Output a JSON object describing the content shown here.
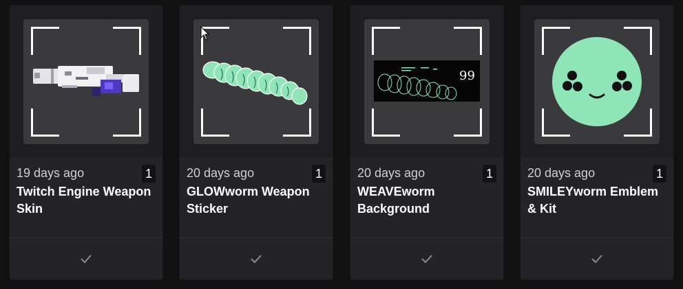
{
  "cards": [
    {
      "date": "19 days ago",
      "count": "1",
      "title": "Twitch Engine Weapon Skin",
      "image": "weapon-skin-image"
    },
    {
      "date": "20 days ago",
      "count": "1",
      "title": "GLOWworm Weapon Sticker",
      "image": "glowworm-sticker-image"
    },
    {
      "date": "20 days ago",
      "count": "1",
      "title": "WEAVEworm Background",
      "image": "weaveworm-background-image",
      "image_text": "99"
    },
    {
      "date": "20 days ago",
      "count": "1",
      "title": "SMILEYworm Emblem & Kit",
      "image": "smileyworm-emblem-image"
    }
  ],
  "colors": {
    "page_bg": "#111112",
    "card_bg": "#242428",
    "frame_bg": "#3a3a3d",
    "accent_green": "#8ee6b8",
    "text_primary": "#ffffff",
    "text_secondary": "#cfcfd4"
  }
}
